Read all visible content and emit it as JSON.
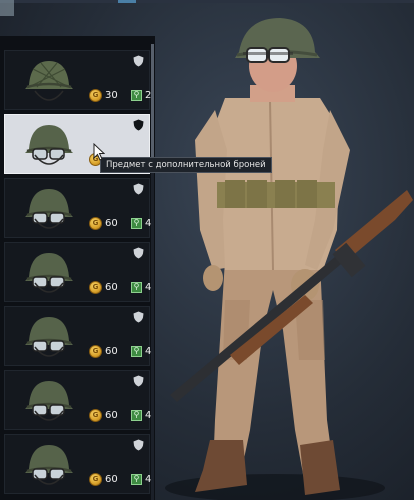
{
  "tooltip": {
    "text": "Предмет с дополнительной броней"
  },
  "items": [
    {
      "name": "helmet-netted",
      "price": "30",
      "level": "2",
      "selected": false,
      "shield_color": "#cfd3d8"
    },
    {
      "name": "helmet-goggles-selected",
      "price": "",
      "level": "",
      "selected": true,
      "shield_color": "#111418"
    },
    {
      "name": "helmet-goggles-2",
      "price": "60",
      "level": "4",
      "selected": false,
      "shield_color": "#cfd3d8"
    },
    {
      "name": "helmet-goggles-3",
      "price": "60",
      "level": "4",
      "selected": false,
      "shield_color": "#cfd3d8"
    },
    {
      "name": "helmet-goggles-4",
      "price": "60",
      "level": "4",
      "selected": false,
      "shield_color": "#cfd3d8"
    },
    {
      "name": "helmet-goggles-5",
      "price": "60",
      "level": "4",
      "selected": false,
      "shield_color": "#cfd3d8"
    },
    {
      "name": "helmet-goggles-6",
      "price": "60",
      "level": "4",
      "selected": false,
      "shield_color": "#cfd3d8"
    }
  ],
  "icons": {
    "currency": "gold-coin-icon",
    "level": "level-icon",
    "armor": "shield-icon"
  }
}
